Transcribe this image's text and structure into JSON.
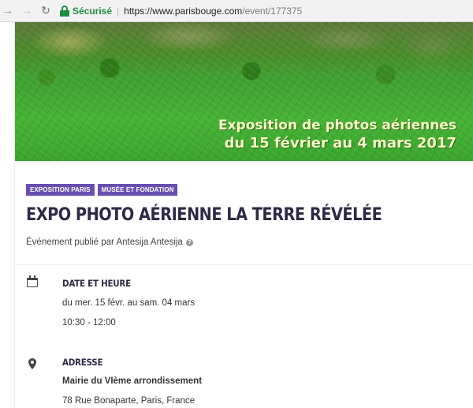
{
  "browser": {
    "secure_label": "Sécurisé",
    "url_host": "https://www.parisbouge.com",
    "url_path": "/event/177375"
  },
  "hero": {
    "line1": "Exposition de photos aériennes",
    "line2": "du 15 février au 4 mars 2017"
  },
  "tags": [
    "EXPOSITION PARIS",
    "MUSÉE ET FONDATION"
  ],
  "event": {
    "title": "EXPO PHOTO AÉRIENNE LA TERRE RÉVÉLÉE",
    "published_by": "Événement publié par Antesija Antesija"
  },
  "date_section": {
    "heading": "DATE ET HEURE",
    "dates": "du mer. 15 févr. au sam. 04 mars",
    "time": "10:30 - 12:00"
  },
  "address_section": {
    "heading": "ADRESSE",
    "venue": "Mairie du VIème arrondissement",
    "street": "78 Rue Bonaparte, Paris, France"
  },
  "icons": {
    "back": "back-arrow-icon",
    "forward": "forward-arrow-icon",
    "reload": "reload-icon",
    "lock": "lock-icon",
    "help": "help-icon",
    "calendar": "calendar-icon",
    "location": "location-pin-icon"
  },
  "colors": {
    "secure_green": "#1e8e3e",
    "tag_purple": "#6a4fb0",
    "title_navy": "#2d2b45"
  }
}
